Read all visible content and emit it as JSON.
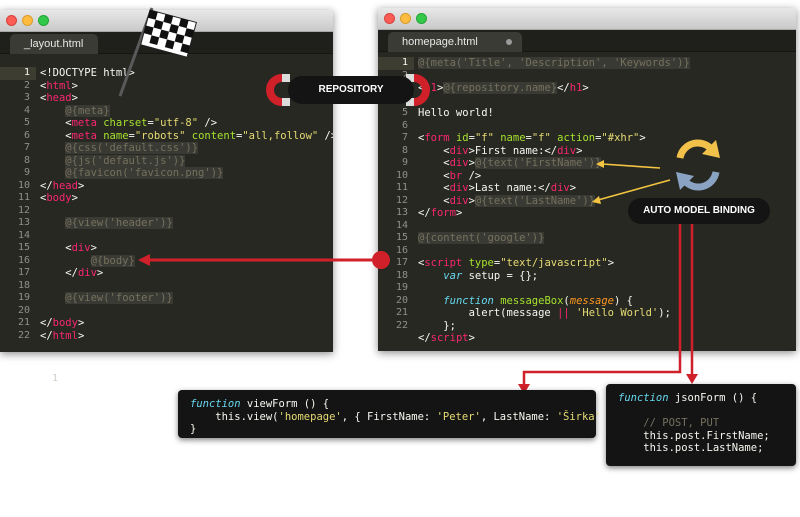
{
  "left_window": {
    "tab": "_layout.html",
    "gutter": [
      "1",
      "2",
      "3",
      "4",
      "5",
      "6",
      "7",
      "8",
      "9",
      "10",
      "11",
      "12",
      "13",
      "14",
      "15",
      "16",
      "17",
      "18",
      "19",
      "20",
      "21",
      "22"
    ],
    "lines": [
      [
        {
          "t": "<!DOCTYPE html>",
          "c": "txt"
        }
      ],
      [
        {
          "t": "<",
          "c": "txt"
        },
        {
          "t": "html",
          "c": "k"
        },
        {
          "t": ">",
          "c": "txt"
        }
      ],
      [
        {
          "t": "<",
          "c": "txt"
        },
        {
          "t": "head",
          "c": "k"
        },
        {
          "t": ">",
          "c": "txt"
        }
      ],
      [
        {
          "t": "    ",
          "c": "txt"
        },
        {
          "t": "@{meta}",
          "c": "hl"
        }
      ],
      [
        {
          "t": "    <",
          "c": "txt"
        },
        {
          "t": "meta",
          "c": "k"
        },
        {
          "t": " ",
          "c": "txt"
        },
        {
          "t": "charset",
          "c": "a"
        },
        {
          "t": "=",
          "c": "txt"
        },
        {
          "t": "\"utf-8\"",
          "c": "s"
        },
        {
          "t": " />",
          "c": "txt"
        }
      ],
      [
        {
          "t": "    <",
          "c": "txt"
        },
        {
          "t": "meta",
          "c": "k"
        },
        {
          "t": " ",
          "c": "txt"
        },
        {
          "t": "name",
          "c": "a"
        },
        {
          "t": "=",
          "c": "txt"
        },
        {
          "t": "\"robots\"",
          "c": "s"
        },
        {
          "t": " ",
          "c": "txt"
        },
        {
          "t": "content",
          "c": "a"
        },
        {
          "t": "=",
          "c": "txt"
        },
        {
          "t": "\"all,follow\"",
          "c": "s"
        },
        {
          "t": " />",
          "c": "txt"
        }
      ],
      [
        {
          "t": "    ",
          "c": "txt"
        },
        {
          "t": "@{css('default.css')}",
          "c": "hl"
        }
      ],
      [
        {
          "t": "    ",
          "c": "txt"
        },
        {
          "t": "@{js('default.js')}",
          "c": "hl"
        }
      ],
      [
        {
          "t": "    ",
          "c": "txt"
        },
        {
          "t": "@{favicon('favicon.png')}",
          "c": "hl"
        }
      ],
      [
        {
          "t": "</",
          "c": "txt"
        },
        {
          "t": "head",
          "c": "k"
        },
        {
          "t": ">",
          "c": "txt"
        }
      ],
      [
        {
          "t": "<",
          "c": "txt"
        },
        {
          "t": "body",
          "c": "k"
        },
        {
          "t": ">",
          "c": "txt"
        }
      ],
      [
        {
          "t": "",
          "c": "txt"
        }
      ],
      [
        {
          "t": "    ",
          "c": "txt"
        },
        {
          "t": "@{view('header')}",
          "c": "hl"
        }
      ],
      [
        {
          "t": "",
          "c": "txt"
        }
      ],
      [
        {
          "t": "    <",
          "c": "txt"
        },
        {
          "t": "div",
          "c": "k"
        },
        {
          "t": ">",
          "c": "txt"
        }
      ],
      [
        {
          "t": "        ",
          "c": "txt"
        },
        {
          "t": "@{body}",
          "c": "hl"
        }
      ],
      [
        {
          "t": "    </",
          "c": "txt"
        },
        {
          "t": "div",
          "c": "k"
        },
        {
          "t": ">",
          "c": "txt"
        }
      ],
      [
        {
          "t": "",
          "c": "txt"
        }
      ],
      [
        {
          "t": "    ",
          "c": "txt"
        },
        {
          "t": "@{view('footer')}",
          "c": "hl"
        }
      ],
      [
        {
          "t": "",
          "c": "txt"
        }
      ],
      [
        {
          "t": "</",
          "c": "txt"
        },
        {
          "t": "body",
          "c": "k"
        },
        {
          "t": ">",
          "c": "txt"
        }
      ],
      [
        {
          "t": "</",
          "c": "txt"
        },
        {
          "t": "html",
          "c": "k"
        },
        {
          "t": ">",
          "c": "txt"
        }
      ]
    ]
  },
  "right_window": {
    "tab": "homepage.html",
    "gutter": [
      "1",
      "2",
      "3",
      "4",
      "5",
      "6",
      "7",
      "8",
      "9",
      "10",
      "11",
      "12",
      "13",
      "14",
      "15",
      "16",
      "17",
      "18",
      "19",
      "20",
      "21",
      "22"
    ],
    "lines": [
      [
        {
          "t": "@{meta('Title', 'Description', 'Keywords')}",
          "c": "hl"
        }
      ],
      [
        {
          "t": "",
          "c": "txt"
        }
      ],
      [
        {
          "t": "<",
          "c": "txt"
        },
        {
          "t": "h1",
          "c": "k"
        },
        {
          "t": ">",
          "c": "txt"
        },
        {
          "t": "@{repository.name}",
          "c": "hl"
        },
        {
          "t": "</",
          "c": "txt"
        },
        {
          "t": "h1",
          "c": "k"
        },
        {
          "t": ">",
          "c": "txt"
        }
      ],
      [
        {
          "t": "",
          "c": "txt"
        }
      ],
      [
        {
          "t": "Hello world!",
          "c": "txt"
        }
      ],
      [
        {
          "t": "",
          "c": "txt"
        }
      ],
      [
        {
          "t": "<",
          "c": "txt"
        },
        {
          "t": "form",
          "c": "k"
        },
        {
          "t": " ",
          "c": "txt"
        },
        {
          "t": "id",
          "c": "a"
        },
        {
          "t": "=",
          "c": "txt"
        },
        {
          "t": "\"f\"",
          "c": "s"
        },
        {
          "t": " ",
          "c": "txt"
        },
        {
          "t": "name",
          "c": "a"
        },
        {
          "t": "=",
          "c": "txt"
        },
        {
          "t": "\"f\"",
          "c": "s"
        },
        {
          "t": " ",
          "c": "txt"
        },
        {
          "t": "action",
          "c": "a"
        },
        {
          "t": "=",
          "c": "txt"
        },
        {
          "t": "\"#xhr\"",
          "c": "s"
        },
        {
          "t": ">",
          "c": "txt"
        }
      ],
      [
        {
          "t": "    <",
          "c": "txt"
        },
        {
          "t": "div",
          "c": "k"
        },
        {
          "t": ">First name:</",
          "c": "txt"
        },
        {
          "t": "div",
          "c": "k"
        },
        {
          "t": ">",
          "c": "txt"
        }
      ],
      [
        {
          "t": "    <",
          "c": "txt"
        },
        {
          "t": "div",
          "c": "k"
        },
        {
          "t": ">",
          "c": "txt"
        },
        {
          "t": "@{text('FirstName')}",
          "c": "hl"
        }
      ],
      [
        {
          "t": "    <",
          "c": "txt"
        },
        {
          "t": "br",
          "c": "k"
        },
        {
          "t": " />",
          "c": "txt"
        }
      ],
      [
        {
          "t": "    <",
          "c": "txt"
        },
        {
          "t": "div",
          "c": "k"
        },
        {
          "t": ">Last name:</",
          "c": "txt"
        },
        {
          "t": "div",
          "c": "k"
        },
        {
          "t": ">",
          "c": "txt"
        }
      ],
      [
        {
          "t": "    <",
          "c": "txt"
        },
        {
          "t": "div",
          "c": "k"
        },
        {
          "t": ">",
          "c": "txt"
        },
        {
          "t": "@{text('LastName')}",
          "c": "hl"
        }
      ],
      [
        {
          "t": "</",
          "c": "txt"
        },
        {
          "t": "form",
          "c": "k"
        },
        {
          "t": ">",
          "c": "txt"
        }
      ],
      [
        {
          "t": "",
          "c": "txt"
        }
      ],
      [
        {
          "t": "@{content('google')}",
          "c": "hl"
        }
      ],
      [
        {
          "t": "",
          "c": "txt"
        }
      ],
      [
        {
          "t": "<",
          "c": "txt"
        },
        {
          "t": "script",
          "c": "k"
        },
        {
          "t": " ",
          "c": "txt"
        },
        {
          "t": "type",
          "c": "a"
        },
        {
          "t": "=",
          "c": "txt"
        },
        {
          "t": "\"text/javascript\"",
          "c": "s"
        },
        {
          "t": ">",
          "c": "txt"
        }
      ],
      [
        {
          "t": "    ",
          "c": "txt"
        },
        {
          "t": "var",
          "c": "f"
        },
        {
          "t": " setup = {};",
          "c": "txt"
        }
      ],
      [
        {
          "t": "",
          "c": "txt"
        }
      ],
      [
        {
          "t": "    ",
          "c": "txt"
        },
        {
          "t": "function",
          "c": "f"
        },
        {
          "t": " ",
          "c": "txt"
        },
        {
          "t": "messageBox",
          "c": "a"
        },
        {
          "t": "(",
          "c": "txt"
        },
        {
          "t": "message",
          "c": "p"
        },
        {
          "t": ") {",
          "c": "txt"
        }
      ],
      [
        {
          "t": "        alert(message ",
          "c": "txt"
        },
        {
          "t": "||",
          "c": "k"
        },
        {
          "t": " ",
          "c": "txt"
        },
        {
          "t": "'Hello World'",
          "c": "s"
        },
        {
          "t": ");",
          "c": "txt"
        }
      ],
      [
        {
          "t": "    };",
          "c": "txt"
        }
      ],
      [
        {
          "t": "</",
          "c": "txt"
        },
        {
          "t": "script",
          "c": "k"
        },
        {
          "t": ">",
          "c": "txt"
        }
      ]
    ]
  },
  "labels": {
    "repository": "REPOSITORY",
    "auto_model_binding": "AUTO MODEL BINDING"
  },
  "view_form_popup": [
    [
      {
        "t": "function",
        "c": "f"
      },
      {
        "t": " viewForm () {",
        "c": "txt"
      }
    ],
    [
      {
        "t": "    this.view(",
        "c": "txt"
      },
      {
        "t": "'homepage'",
        "c": "s"
      },
      {
        "t": ", { FirstName: ",
        "c": "txt"
      },
      {
        "t": "'Peter'",
        "c": "s"
      },
      {
        "t": ", LastName: ",
        "c": "txt"
      },
      {
        "t": "'Širka'",
        "c": "s"
      },
      {
        "t": " });",
        "c": "txt"
      }
    ],
    [
      {
        "t": "}",
        "c": "txt"
      }
    ]
  ],
  "json_form_popup": [
    [
      {
        "t": "function",
        "c": "f"
      },
      {
        "t": " jsonForm () {",
        "c": "txt"
      }
    ],
    [
      {
        "t": "",
        "c": "txt"
      }
    ],
    [
      {
        "t": "    // POST, PUT",
        "c": "d"
      }
    ],
    [
      {
        "t": "    this.post.FirstName;",
        "c": "txt"
      }
    ],
    [
      {
        "t": "    this.post.LastName;",
        "c": "txt"
      }
    ]
  ],
  "colors": {
    "editor_bg": "#272822",
    "arrow_red": "#d0202a",
    "arrow_yellow": "#f4c542",
    "refresh_yellow": "#f2c14a",
    "refresh_blue": "#8aa3c2"
  },
  "icons": [
    "checkered-flag-icon",
    "magnet-icon",
    "refresh-icon"
  ]
}
